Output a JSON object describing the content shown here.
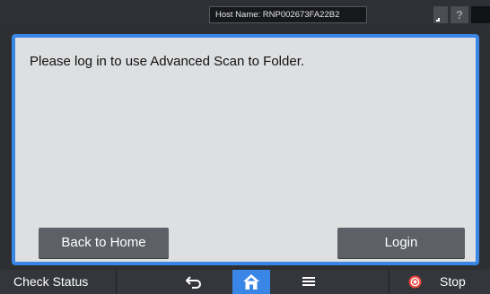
{
  "topbar": {
    "host_name": "Host Name: RNP002673FA22B2",
    "help_label": "?"
  },
  "dialog": {
    "message": "Please log in to use Advanced Scan to Folder.",
    "back_label": "Back to Home",
    "login_label": "Login"
  },
  "bottombar": {
    "status_label": "Check Status",
    "stop_label": "Stop"
  },
  "colors": {
    "accent": "#3a86e6",
    "dialog_bg": "#dedfe1",
    "button_bg": "#5d6066",
    "stop_red": "#e8453c"
  },
  "icons": [
    "ready-indicator-icon",
    "help-icon",
    "energy-saver-moon-icon",
    "back-arrow-icon",
    "home-icon",
    "menu-icon",
    "stop-icon"
  ]
}
